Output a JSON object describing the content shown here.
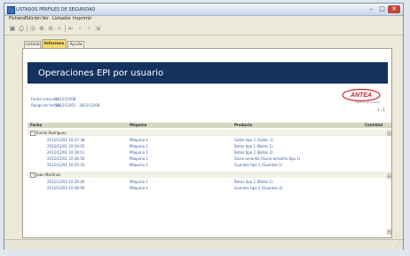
{
  "window": {
    "title": "LISTADOS PERFILES DE SEGURIDAD"
  },
  "menu": [
    "Fichero",
    "Edición",
    "Ver",
    "Listados",
    "Imprimir"
  ],
  "toolbar": [
    "save-icon",
    "print-icon",
    "preview-icon",
    "zoom-in-icon",
    "zoom-out-icon",
    "search-icon",
    "first-page-icon",
    "prev-page-icon",
    "next-page-icon",
    "export-icon"
  ],
  "tabs": [
    "Listado",
    "Informes",
    "Ayuda"
  ],
  "active_tab": "Informes",
  "report": {
    "title": "Operaciones EPI por usuario",
    "fecha_label": "Fecha creación:",
    "fecha_value": "2012/12/08",
    "rango_label": "Rango de fechas:",
    "rango_value": "2012/12/01 - 2012/12/08",
    "logo_text": "ANTEA",
    "logo_subtext": "soluciones de seguridad",
    "zoom": "1 : 1",
    "columns": {
      "fecha": "Fecha",
      "maquina": "Máquina",
      "producto": "Producto",
      "cantidad": "Cantidad"
    },
    "groups": [
      {
        "name": "Emilio Rodríguez",
        "rows": [
          {
            "fecha": "2012/12/01 10:27:38",
            "maquina": "Máquina 1",
            "producto": "Gafas tipo 1 (Gafas 1)"
          },
          {
            "fecha": "2012/12/01 10:34:05",
            "maquina": "Máquina 1",
            "producto": "Botas tipo 1 (Botas 1)"
          },
          {
            "fecha": "2012/12/01 10:39:11",
            "maquina": "Máquina 1",
            "producto": "Botas tipo 2 (Botas 2)"
          },
          {
            "fecha": "2012/12/01 10:48:56",
            "maquina": "Máquina 1",
            "producto": "Gorro amarillo (Gorro amarillo tipo 1)"
          },
          {
            "fecha": "2012/12/01 10:55:33",
            "maquina": "Máquina 1",
            "producto": "Guantes tipo 1 (Guantes 1)"
          }
        ]
      },
      {
        "name": "Juan Martínez",
        "rows": [
          {
            "fecha": "2012/12/03 10:29:46",
            "maquina": "Máquina 1",
            "producto": "Botas tipo 1 (Botas 1)"
          },
          {
            "fecha": "2012/12/03 10:48:06",
            "maquina": "Máquina 1",
            "producto": "Guantes tipo 2 (Guantes 2)"
          }
        ]
      }
    ]
  },
  "colors": {
    "title_bar": "#14325e",
    "header_bg": "#d6d7c0",
    "active_tab": "#f7d86a",
    "close_button": "#c8453a",
    "link_blue": "#3d5a9a",
    "logo_red": "#c4262e"
  }
}
